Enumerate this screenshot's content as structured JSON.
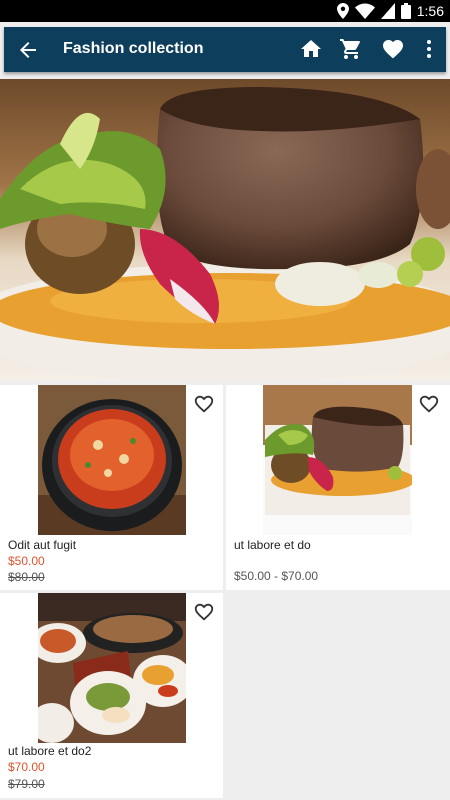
{
  "status_bar": {
    "time": "1:56"
  },
  "app_bar": {
    "title": "Fashion collection",
    "icons": [
      "back-arrow-icon",
      "home-icon",
      "cart-icon",
      "heart-icon",
      "more-vert-icon"
    ]
  },
  "products": [
    {
      "name": "Odit aut fugit",
      "price": "$50.00",
      "old_price": "$80.00",
      "image": "soup-pot"
    },
    {
      "name": "ut labore et do",
      "price_range": "$50.00 - $70.00",
      "image": "steak-plate"
    },
    {
      "name": "ut labore et do2",
      "price": "$70.00",
      "old_price": "$79.00",
      "image": "fajita-table"
    }
  ],
  "colors": {
    "app_bar": "#0d3e5c",
    "sale_price": "#e0532f",
    "background": "#eeeeee"
  }
}
